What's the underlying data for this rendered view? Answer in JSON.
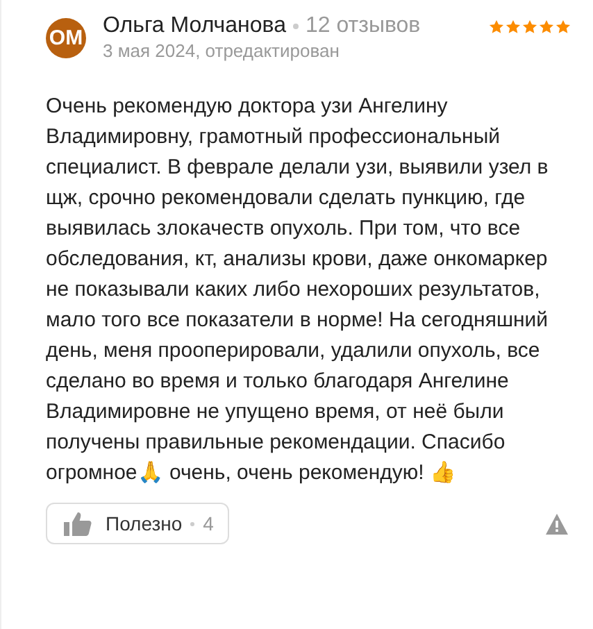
{
  "review": {
    "avatar": "ОМ",
    "author": "Ольга Молчанова",
    "reviews_count": "12 отзывов",
    "date": "3 мая 2024, отредактирован",
    "stars": 5,
    "text": "Очень рекомендую доктора узи Ангелину Владимировну, грамотный профессиональный специалист. В феврале делали узи, выявили узел в щж, срочно рекомендовали сделать пункцию, где выявилась злокачеств опухоль. При том, что все обследования, кт, анализы крови, даже онкомаркер не показывали каких либо нехороших результатов, мало того все показатели в норме! На сегодняшний день, меня прооперировали, удалили опухоль, все сделано во время и только благодаря Ангелине Владимировне не упущено время, от неё были получены правильные рекомендации. Спасибо огромное🙏 очень, очень рекомендую! 👍",
    "helpful": {
      "label": "Полезно",
      "count": "4"
    }
  }
}
